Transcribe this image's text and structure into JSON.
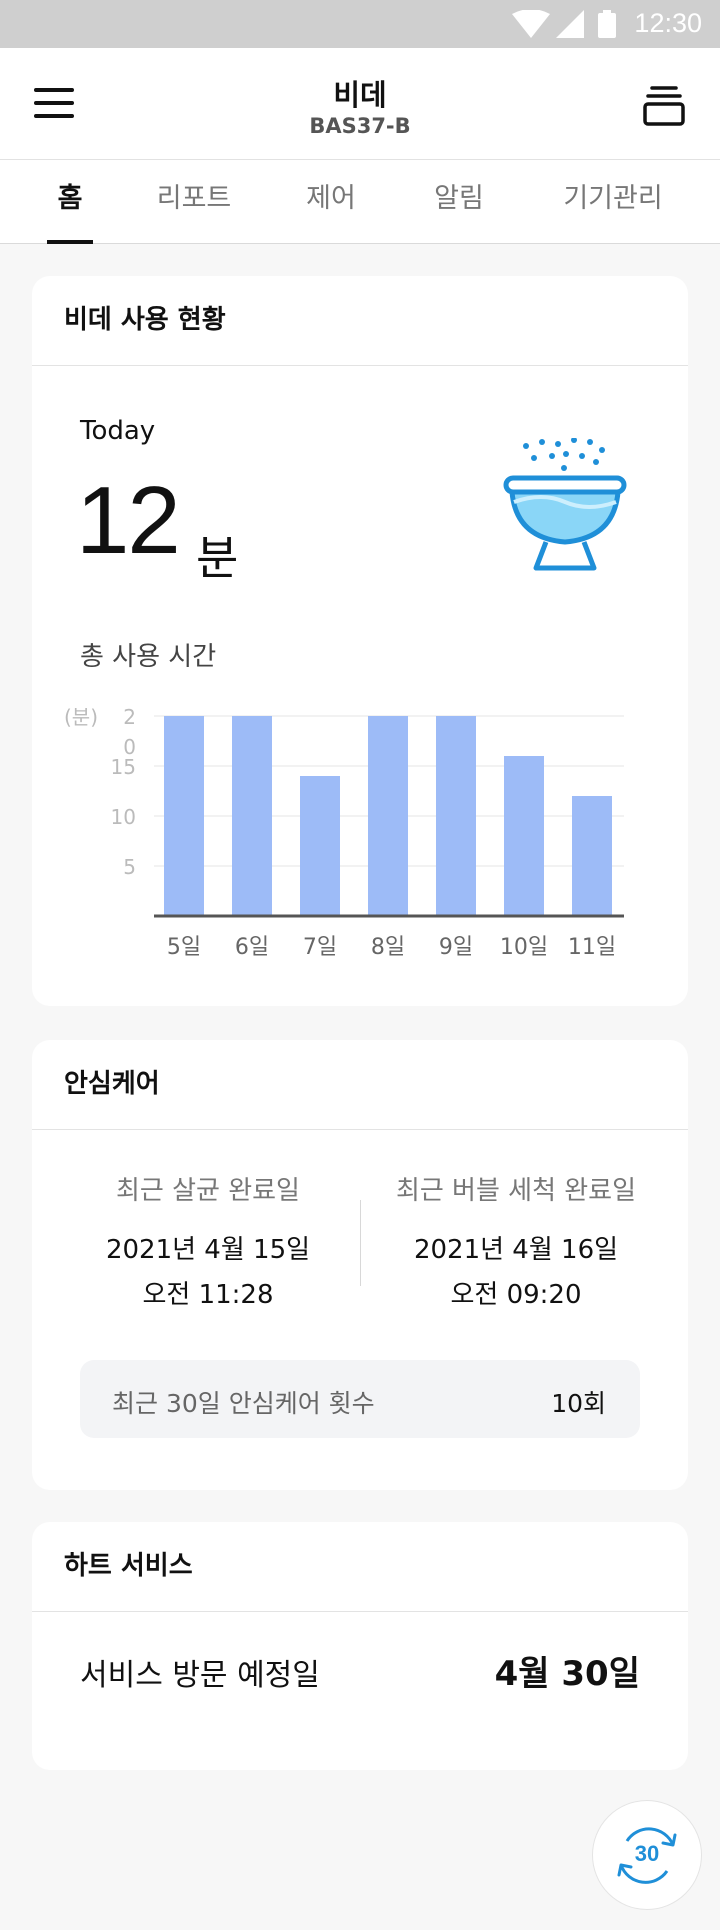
{
  "status_bar": {
    "time": "12:30"
  },
  "app_bar": {
    "title": "비데",
    "subtitle": "BAS37-B"
  },
  "tabs": [
    {
      "label": "홈",
      "active": true
    },
    {
      "label": "리포트",
      "active": false
    },
    {
      "label": "제어",
      "active": false
    },
    {
      "label": "알림",
      "active": false
    },
    {
      "label": "기기관리",
      "active": false
    }
  ],
  "usage_card": {
    "title": "비데 사용 현황",
    "today_label": "Today",
    "today_value": "12",
    "today_unit": "분",
    "chart_title": "총 사용 시간"
  },
  "chart_data": {
    "type": "bar",
    "categories": [
      "5일",
      "6일",
      "7일",
      "8일",
      "9일",
      "10일",
      "11일"
    ],
    "values": [
      20,
      20,
      14,
      20,
      20,
      16,
      12
    ],
    "yticks": [
      "5",
      "10",
      "15"
    ],
    "ytop_label": "2\n0",
    "yunit": "(분)",
    "ylim": [
      0,
      20
    ],
    "bar_color": "#9dbbf7"
  },
  "care_card": {
    "title": "안심케어",
    "sterilize_label": "최근 살균 완료일",
    "sterilize_date": "2021년 4월 15일",
    "sterilize_time": "오전 11:28",
    "bubble_label": "최근 버블 세척 완료일",
    "bubble_date": "2021년 4월 16일",
    "bubble_time": "오전 09:20",
    "count_label": "최근 30일 안심케어 횟수",
    "count_value": "10회"
  },
  "heart_card": {
    "title": "하트 서비스",
    "visit_label": "서비스 방문 예정일",
    "visit_value": "4월 30일"
  },
  "fab": {
    "label": "30"
  },
  "colors": {
    "accent": "#1f8fd8",
    "bar": "#9dbbf7"
  }
}
